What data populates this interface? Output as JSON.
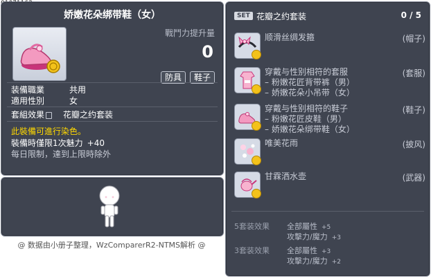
{
  "item_code": "01071163",
  "item": {
    "title": "娇嫩花朵绑带鞋（女）",
    "power_label": "戰鬥力提升量",
    "power_value": "0",
    "tags": [
      "防具",
      "鞋子"
    ],
    "job_label": "装備職業",
    "job_value": "共用",
    "gender_label": "適用性別",
    "gender_value": "女",
    "set_label": "套組效果",
    "set_value": "花瓣之约套装",
    "dye_note": "此裝備可進行染色。",
    "limit_label": "裝備時僅限1次魅力",
    "limit_value": "+40",
    "reset_note": "每日限制，達到上限時除外"
  },
  "footer": "@ 数据由小册子整理，WzComparerR2-NTMS解析 @",
  "set": {
    "badge": "SET",
    "title": "花瓣之约套装",
    "count": "0 / 5",
    "items": [
      {
        "name": "顺滑丝绸发箍",
        "slot": "(帽子)",
        "lines": []
      },
      {
        "name": "穿戴与性别相符的套服",
        "slot": "(套服)",
        "lines": [
          "– 粉嫩花匠背带裤（男）",
          "– 娇嫩花朵小吊带（女）"
        ]
      },
      {
        "name": "穿戴与性别相符的鞋子",
        "slot": "(鞋子)",
        "lines": [
          "– 粉嫩花匠皮鞋（男）",
          "– 娇嫩花朵绑带鞋（女）"
        ]
      },
      {
        "name": "唯美花雨",
        "slot": "(披风)",
        "lines": []
      },
      {
        "name": "甘霖洒水壶",
        "slot": "(武器)",
        "lines": []
      }
    ],
    "effects": [
      {
        "label": "5套装效果",
        "stats": [
          {
            "name": "全部屬性",
            "value": "+5"
          },
          {
            "name": "攻擊力/魔力",
            "value": "+3"
          }
        ]
      },
      {
        "label": "3套装效果",
        "stats": [
          {
            "name": "全部屬性",
            "value": "+3"
          },
          {
            "name": "攻擊力/魔力",
            "value": "+2"
          }
        ]
      }
    ]
  },
  "icons": {
    "item_icon": "pink-shoe-icon",
    "coin": "coin-icon",
    "lock": "lock-icon",
    "avatar": "character-avatar"
  },
  "colors": {
    "panel_bg": "#3f4450",
    "dye_note": "#ffd800",
    "coin": "#f3c21a"
  }
}
